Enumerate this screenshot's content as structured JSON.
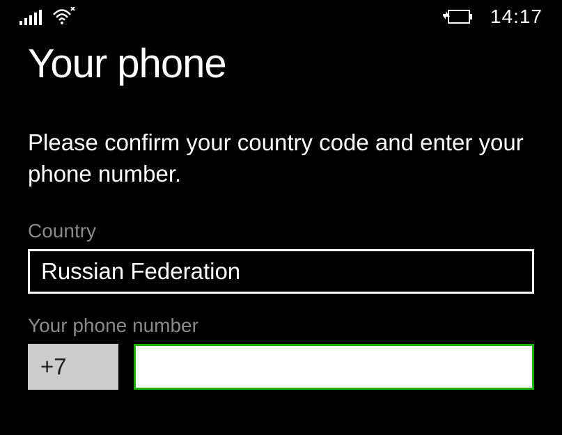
{
  "status_bar": {
    "clock": "14:17"
  },
  "page": {
    "title": "Your phone",
    "instruction": "Please confirm your country code and enter your phone number."
  },
  "form": {
    "country_label": "Country",
    "country_value": "Russian Federation",
    "phone_label": "Your phone number",
    "country_code": "+7",
    "phone_value": ""
  }
}
